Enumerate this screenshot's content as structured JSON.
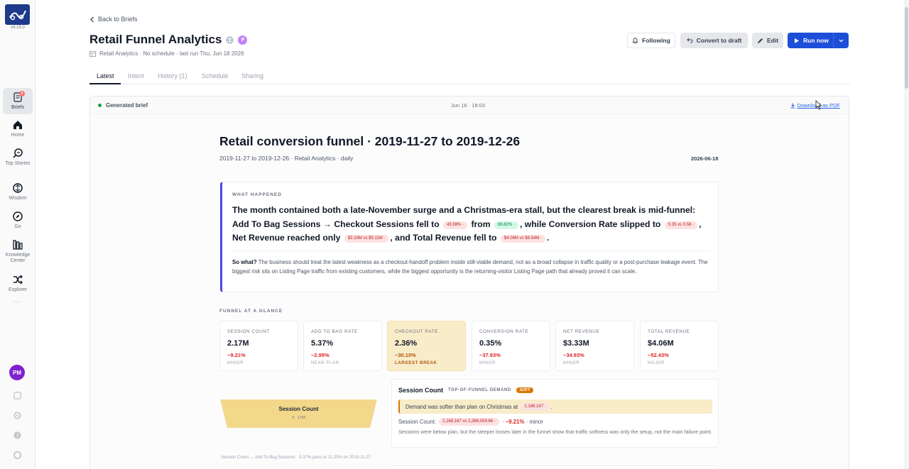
{
  "app": {
    "version": "v4.15.0"
  },
  "rail": {
    "items": [
      {
        "label": "Briefs",
        "badge": "8"
      },
      {
        "label": "Home"
      },
      {
        "label": "Top Stories"
      },
      {
        "label": "Wisdom"
      },
      {
        "label": "Go"
      },
      {
        "label": "Knowledge Center"
      },
      {
        "label": "Explorer"
      }
    ],
    "more": "···",
    "avatar": "PM"
  },
  "header": {
    "back": "Back to Briefs",
    "title": "Retail Funnel Analytics",
    "owner_chip": "P",
    "subtitle": "Retail Analytics · No schedule · last run Thu, Jun 18 2026"
  },
  "actions": {
    "following": "Following",
    "convert": "Convert to draft",
    "edit": "Edit",
    "run": "Run now"
  },
  "tabs": [
    "Latest",
    "Intent",
    "History (1)",
    "Schedule",
    "Sharing"
  ],
  "brief_bar": {
    "status": "Generated brief",
    "time": "Jun 18 · 18:03",
    "download": "Download as PDF"
  },
  "doc": {
    "title": "Retail conversion funnel · 2019-11-27 to 2019-12-26",
    "meta": "2019-11-27 to 2019-12-26 · Retail Analytics · daily",
    "date": "2026-06-18"
  },
  "what_happened": {
    "label": "WHAT HAPPENED",
    "h1": "The month contained both a late-November surge and a Christmas-era stall, but the clearest break is mid-funnel: Add To Bag Sessions → Checkout Sessions fell to",
    "p1": "43.98% ·",
    "h2": "from",
    "p2": "69.82% ·",
    "h3": ", while Conversion Rate slipped to",
    "p3": "0.35 vs 0.56 ·",
    "h4": ", Net Revenue reached only",
    "p4": "$3.33M vs $5.11M ·",
    "h5": ", and Total Revenue fell to",
    "p5": "$4.06M vs $8.54M ·",
    "h6": ".",
    "so_what_label": "So what?",
    "so_what": "The business should treat the latest weakness as a checkout-handoff problem inside still-viable demand, not as a broad collapse in traffic quality or a post-purchase leakage event. The biggest risk sits on Listing Page traffic from existing customers, while the biggest opportunity is the returning-visitor Listing Page path that already proved it can scale."
  },
  "glance": {
    "label": "FUNNEL AT A GLANCE",
    "cards": [
      {
        "k": "SESSION COUNT",
        "v": "2.17M",
        "d": "−9.21%",
        "s": "MINOR"
      },
      {
        "k": "ADD TO BAG RATE",
        "v": "5.37%",
        "d": "−2.99%",
        "s": "NEAR PLAN"
      },
      {
        "k": "CHECKOUT RATE",
        "v": "2.36%",
        "d": "−30.10%",
        "s": "LARGEST BREAK"
      },
      {
        "k": "CONVERSION RATE",
        "v": "0.35%",
        "d": "−37.93%",
        "s": "MINOR"
      },
      {
        "k": "NET REVENUE",
        "v": "$3.33M",
        "d": "−34.93%",
        "s": "MINOR"
      },
      {
        "k": "TOTAL REVENUE",
        "v": "$4.06M",
        "d": "−52.43%",
        "s": "MAJOR"
      }
    ]
  },
  "funnel": {
    "stage": "Session Count",
    "value": "2 · 17M",
    "note": "Session Count → Add To Bag Sessions · 5.37% pass vs 11.25% on 2019-11-27",
    "color": "#f3d88b"
  },
  "detail": {
    "title": "Session Count",
    "tag": "TOP-OF-FUNNEL DEMAND",
    "badge": "SOFT",
    "callout_text": "Demand was softer than plan on Christmas at",
    "callout_pill": "2,168,167 ·",
    "callout_end": ".",
    "line_label": "Session Count:",
    "line_pill": "2,168,167 vs 2,388,059.66 ·",
    "line_sep": "·",
    "line_delta": "−9.21%",
    "line_tail": "· minor",
    "note": "Sessions were below plan, but the steeper losses later in the funnel show that traffic softness was only the setup, not the main failure point."
  },
  "colors": {
    "accent": "#1d4ed8",
    "warn": "#d97706",
    "negative": "#dc2626",
    "ok": "#16a34a",
    "highlight": "#f9ecc9"
  }
}
